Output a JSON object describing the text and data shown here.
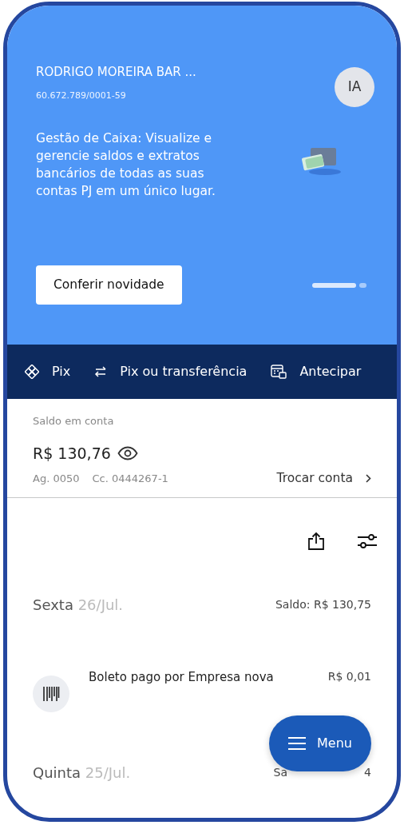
{
  "header": {
    "company": "RODRIGO MOREIRA BAR ...",
    "cnpj": "60.672.789/0001-59",
    "avatar": "IA"
  },
  "banner": {
    "text": "Gestão de Caixa: Visualize e gerencie saldos e extratos bancários de todas as suas contas PJ em um único lugar.",
    "button": "Conferir novidade",
    "dots": [
      {
        "selected": true
      },
      {
        "selected": false
      }
    ]
  },
  "actions": [
    {
      "kind": "pix",
      "label": "Pix"
    },
    {
      "kind": "transfer",
      "label": "Pix ou transferência"
    },
    {
      "kind": "calendar",
      "label": "Antecipar"
    }
  ],
  "balance": {
    "label": "Saldo em conta",
    "amount": "R$ 130,76",
    "agency": "Ag. 0050",
    "account": "Cc. 0444267-1",
    "switch": "Trocar conta"
  },
  "days": [
    {
      "weekday": "Sexta",
      "date": "26/Jul.",
      "balance": [
        "Saldo: R$ 130,75"
      ],
      "transactions": [
        {
          "description": "Boleto pago por Empresa nova",
          "amount": "R$ 0,01"
        }
      ]
    },
    {
      "weekday": "Quinta",
      "date": "25/Jul.",
      "balance": [
        "Sa",
        "4"
      ]
    }
  ],
  "menu_button": "Menu"
}
